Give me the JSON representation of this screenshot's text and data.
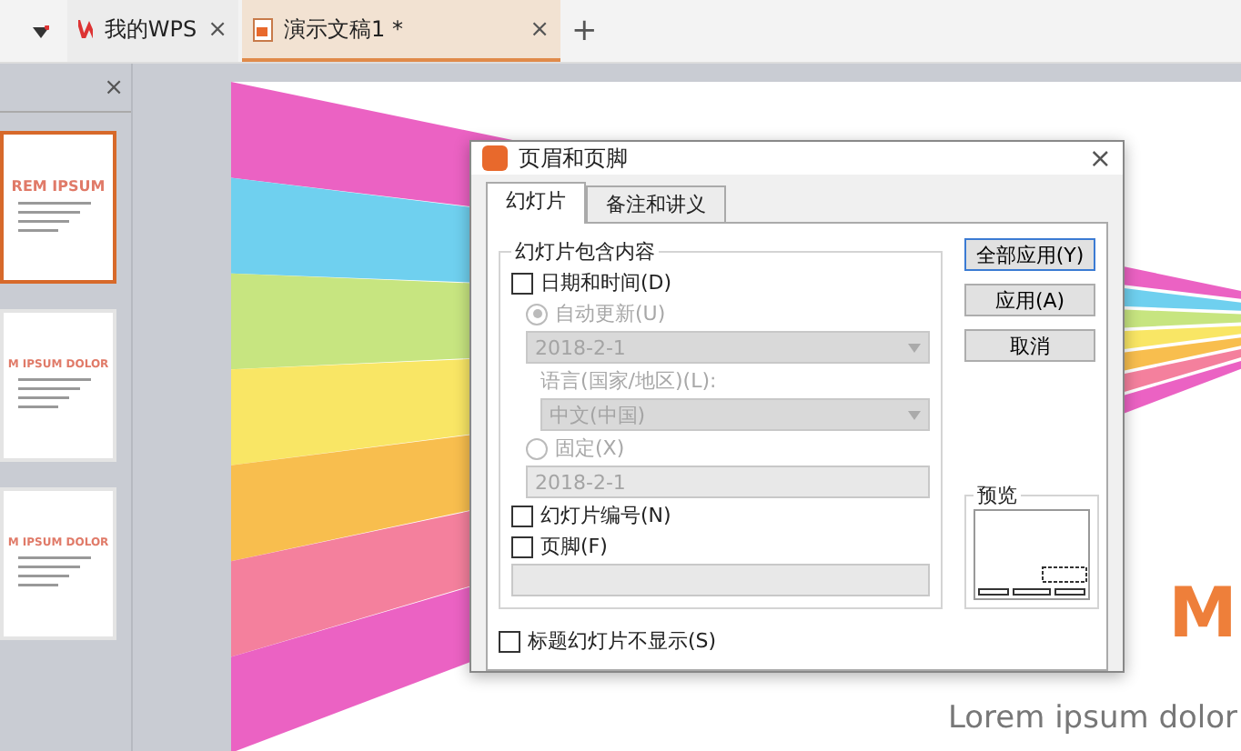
{
  "tabs": [
    {
      "kind": "home",
      "label": "我的WPS",
      "selected": false,
      "close": "×"
    },
    {
      "kind": "doc",
      "label": "演示文稿1 *",
      "selected": true,
      "close": "×"
    }
  ],
  "new_tab": "+",
  "thumbnail_panel": {
    "close": "×",
    "thumbnails": [
      {
        "title": "REM IPSUM",
        "selected": true
      },
      {
        "title": "M IPSUM DOLOR",
        "selected": false
      },
      {
        "title": "M IPSUM DOLOR",
        "selected": false
      }
    ]
  },
  "slide": {
    "title": "M",
    "subtitle": "Lorem ipsum dolor"
  },
  "dialog": {
    "title": "页眉和页脚",
    "close": "×",
    "tabs": [
      {
        "label": "幻灯片",
        "selected": true
      },
      {
        "label": "备注和讲义",
        "selected": false
      }
    ],
    "group_title": "幻灯片包含内容",
    "date_time": {
      "label": "日期和时间(D)",
      "checked": false
    },
    "auto_update": {
      "label": "自动更新(U)",
      "selected": true,
      "disabled": true
    },
    "auto_date": {
      "value": "2018-2-1",
      "disabled": true
    },
    "language_label": "语言(国家/地区)(L):",
    "language": {
      "value": "中文(中国)",
      "disabled": true
    },
    "fixed": {
      "label": "固定(X)",
      "selected": false,
      "disabled": true
    },
    "fixed_date": {
      "value": "2018-2-1",
      "disabled": true
    },
    "slide_number": {
      "label": "幻灯片编号(N)",
      "checked": false
    },
    "footer": {
      "label": "页脚(F)",
      "checked": false
    },
    "footer_text": {
      "disabled": true
    },
    "hide_on_title": {
      "label": "标题幻灯片不显示(S)",
      "checked": false
    },
    "buttons": [
      {
        "label": "全部应用(Y)",
        "default": true
      },
      {
        "label": "应用(A)",
        "default": false
      },
      {
        "label": "取消",
        "default": false
      }
    ],
    "preview_label": "预览"
  }
}
